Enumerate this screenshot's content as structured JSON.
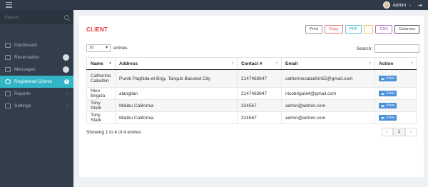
{
  "topbar": {
    "user_name": "Admin",
    "caret": "⌄",
    "signout_icon": "sign-out-icon"
  },
  "sidebar": {
    "search_placeholder": "Search...",
    "items": [
      {
        "label": "Dashboard",
        "icon": "dashboard-icon"
      },
      {
        "label": "Reservation",
        "icon": "calendar-icon",
        "badge": true
      },
      {
        "label": "Messages",
        "icon": "envelope-icon",
        "badge": true
      },
      {
        "label": "Registered Clients",
        "icon": "users-icon",
        "active": true,
        "badge_text": "1"
      },
      {
        "label": "Reports",
        "icon": "report-icon",
        "chevron": "›"
      },
      {
        "label": "Settings",
        "icon": "gear-icon",
        "chevron": "›"
      }
    ]
  },
  "page": {
    "title": "CLIENT",
    "export_buttons": {
      "print": "Print",
      "copy": "Copy",
      "pdf": "PDF",
      "excel": "",
      "csv": "CSV",
      "columns": "Columns"
    },
    "length_value": "10",
    "length_suffix": "entries",
    "search_label": "Search:",
    "search_value": ""
  },
  "table": {
    "columns": [
      "Name",
      "Address",
      "Contact #",
      "Email",
      "Action"
    ],
    "action_label": "View",
    "rows": [
      {
        "name": "Catherine Cabalhin",
        "address": "Purok Paghida-et Brgy. Tangub Bacolod City",
        "contact": "2147483647",
        "email": "catherinecabalhin55@gmail.com"
      },
      {
        "name": "Nico Brigula",
        "address": "alangilan",
        "contact": "2147483647",
        "email": "nicobrigula4@gmail.com"
      },
      {
        "name": "Tony Stark",
        "address": "Malibu California",
        "contact": "324567",
        "email": "admin@admin.com"
      },
      {
        "name": "Tony Stark",
        "address": "Malibu California",
        "contact": "324567",
        "email": "admin@admin.com"
      }
    ]
  },
  "footer": {
    "info": "Showing 1 to 4 of 4 entries",
    "prev": "‹",
    "page": "1",
    "next": "›"
  },
  "colors": {
    "accent": "#33b5c8",
    "title": "#e23b3b",
    "view_button": "#4a90d9",
    "sidebar": "#323e4b"
  }
}
